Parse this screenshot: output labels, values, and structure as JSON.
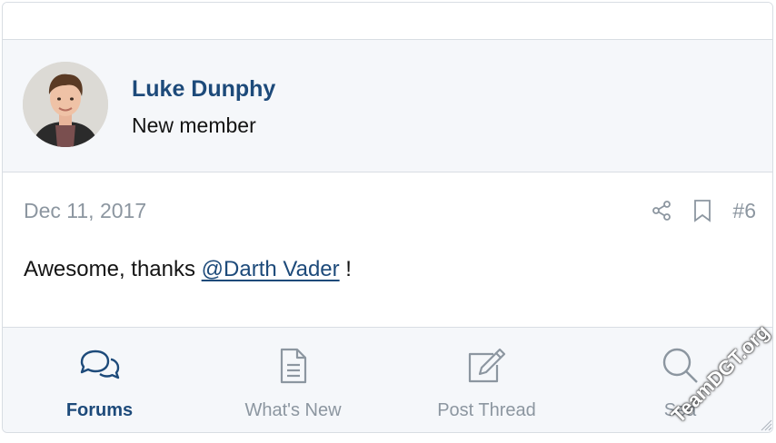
{
  "user": {
    "name": "Luke Dunphy",
    "title": "New member"
  },
  "post": {
    "date": "Dec 11, 2017",
    "number": "#6",
    "body_prefix": "Awesome, thanks ",
    "mention": "@Darth Vader",
    "body_suffix": " !"
  },
  "nav": {
    "items": [
      {
        "label": "Forums",
        "icon": "chat-bubbles-icon",
        "active": true
      },
      {
        "label": "What's New",
        "icon": "document-icon",
        "active": false
      },
      {
        "label": "Post Thread",
        "icon": "edit-icon",
        "active": false
      },
      {
        "label": "Sea",
        "icon": "search-icon",
        "active": false
      }
    ]
  },
  "watermark": "TeamDGT.org",
  "colors": {
    "accent": "#1d4a7a",
    "muted": "#8c96a0",
    "panel": "#f5f7fa",
    "border": "#d8dde3"
  }
}
